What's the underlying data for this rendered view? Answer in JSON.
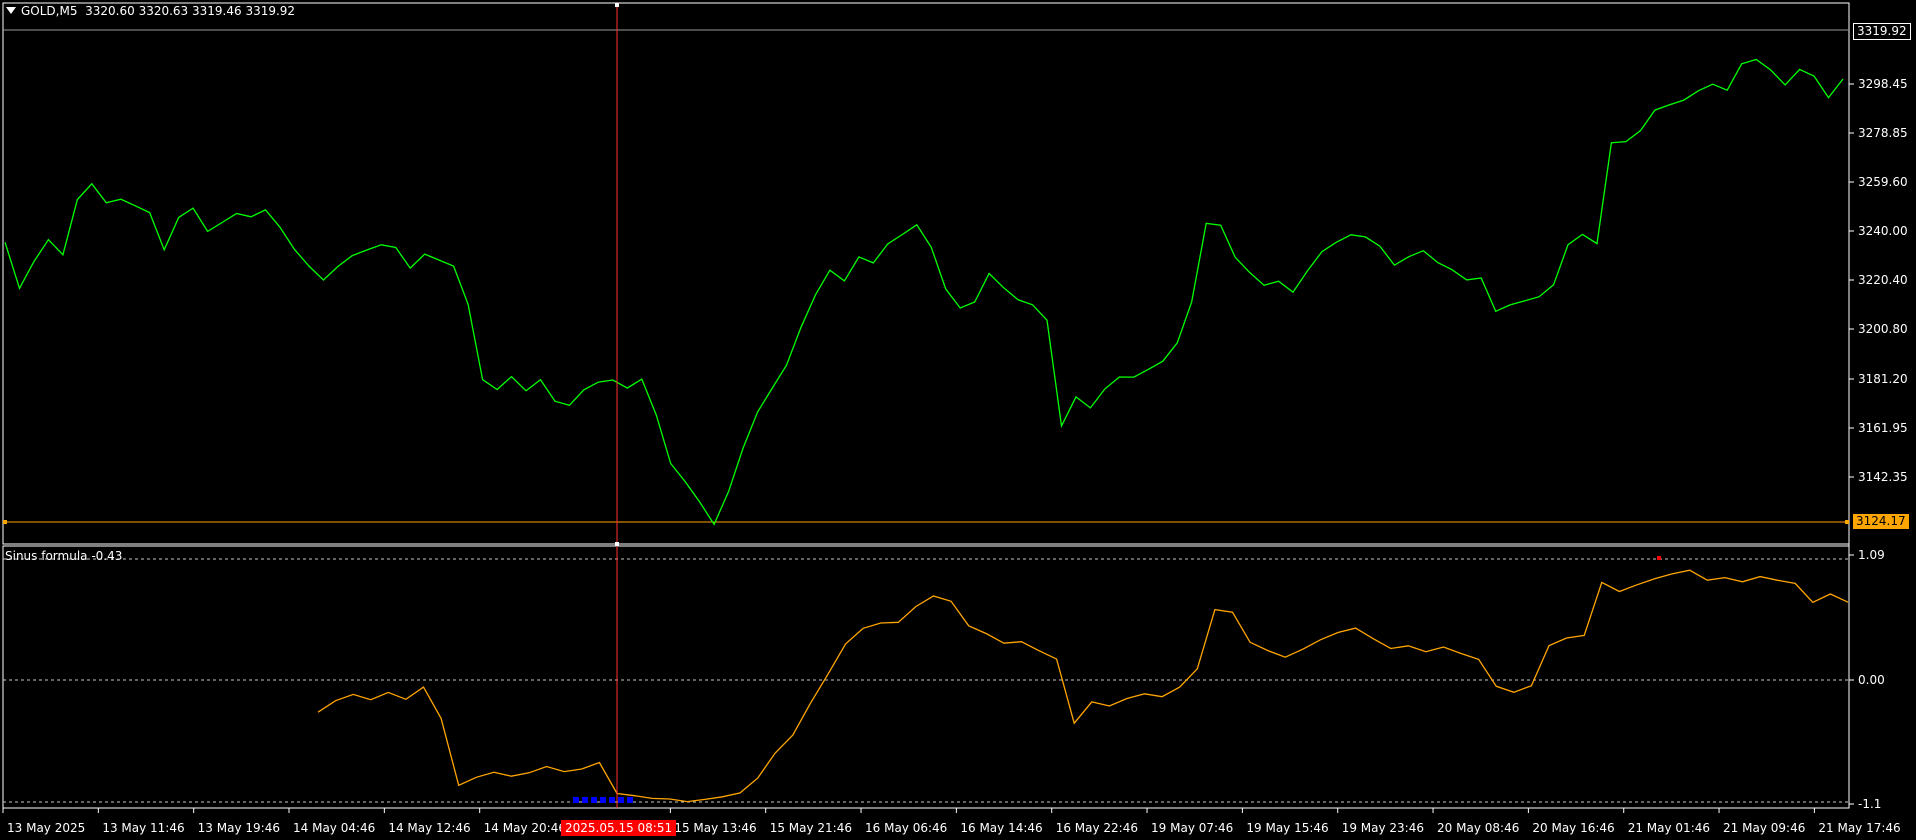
{
  "header": {
    "symbol": "GOLD,M5",
    "ohlc": "3320.60 3320.63 3319.46 3319.92"
  },
  "indicator": {
    "title": "Sinus formula -0.43"
  },
  "price_tags": {
    "current": "3319.92",
    "level": "3124.17"
  },
  "crosshair": {
    "time_label": "2025.05.15 08:51"
  },
  "colors": {
    "background": "#000000",
    "price_line": "#00FF00",
    "indicator_line": "#FFA500",
    "crosshair": "#FF3030",
    "level_line": "#FFA500",
    "low_markers": "#0000FF",
    "high_marker": "#FF0000",
    "axis": "#FFFFFF"
  },
  "chart_data": [
    {
      "type": "line",
      "title": "GOLD,M5",
      "y_ticks": [
        "3319.92",
        "3298.45",
        "3278.85",
        "3259.60",
        "3240.00",
        "3220.40",
        "3200.80",
        "3181.20",
        "3161.95",
        "3142.35"
      ],
      "ylim": [
        3130,
        3325
      ],
      "x_tick_labels": [
        "13 May 2025",
        "13 May 11:46",
        "13 May 19:46",
        "14 May 04:46",
        "14 May 12:46",
        "14 May 20:46",
        "15 May 13:46",
        "15 May 21:46",
        "16 May 06:46",
        "16 May 14:46",
        "16 May 22:46",
        "19 May 07:46",
        "19 May 15:46",
        "19 May 23:46",
        "20 May 08:46",
        "20 May 16:46",
        "21 May 01:46",
        "21 May 09:46",
        "21 May 17:46"
      ],
      "x_tick_positions": [
        0,
        4,
        8,
        12,
        16,
        20,
        28,
        32,
        36,
        40,
        44,
        48,
        52,
        56,
        60,
        64,
        68,
        72,
        76
      ],
      "series": [
        {
          "values": [
            3240,
            3222,
            3233,
            3242,
            3236,
            3258,
            3264,
            3256,
            3257,
            3254,
            3251,
            3236,
            3249,
            3253,
            3244,
            3248,
            3252,
            3251,
            3254,
            3247,
            3238,
            3231,
            3225,
            3230,
            3234,
            3236,
            3238,
            3237,
            3229,
            3235,
            3233,
            3231,
            3216,
            3186,
            3182,
            3187,
            3181,
            3185,
            3176,
            3174,
            3180,
            3183,
            3184,
            3181,
            3185,
            3171,
            3152,
            3145,
            3137,
            3128,
            3141,
            3158,
            3172,
            3181,
            3190,
            3205,
            3218,
            3228,
            3224,
            3234,
            3232,
            3240,
            3244,
            3248,
            3239,
            3222,
            3214,
            3216,
            3227,
            3221,
            3216,
            3214,
            3208,
            3166,
            3178,
            3174,
            3182,
            3187,
            3187,
            3190,
            3193,
            3200,
            3216,
            3247,
            3246,
            3233,
            3227,
            3222,
            3224,
            3220,
            3229,
            3237,
            3241,
            3244,
            3243,
            3239,
            3231,
            3234,
            3236,
            3231,
            3228,
            3224,
            3225,
            3212,
            3215,
            3217,
            3219,
            3224,
            3240,
            3244,
            3240,
            3280,
            3280,
            3284,
            3292,
            3294,
            3296,
            3300,
            3303,
            3301,
            3312,
            3314,
            3310,
            3304,
            3310,
            3307,
            3298,
            3305
          ]
        }
      ]
    },
    {
      "type": "line",
      "title": "Sinus formula -0.43",
      "y_ticks": [
        "1.09",
        "0.00",
        "-1.1"
      ],
      "ylim": [
        -1.12,
        1.1
      ],
      "series": [
        {
          "values": [
            -0.3,
            -0.18,
            -0.12,
            -0.18,
            -0.13,
            -0.2,
            -0.08,
            -0.35,
            -0.95,
            -0.88,
            -0.85,
            -0.9,
            -0.87,
            -0.8,
            -0.83,
            -0.8,
            -0.75,
            -1.05,
            -1.08,
            -1.1,
            -1.09,
            -1.1,
            -1.08,
            -1.07,
            -1.05,
            -0.92,
            -0.68,
            -0.5,
            -0.2,
            0.06,
            0.32,
            0.45,
            0.5,
            0.52,
            0.68,
            0.78,
            0.72,
            0.48,
            0.4,
            0.32,
            0.35,
            0.28,
            0.2,
            -0.4,
            -0.22,
            -0.26,
            -0.18,
            -0.12,
            -0.14,
            -0.06,
            0.09,
            0.62,
            0.6,
            0.34,
            0.28,
            0.22,
            0.28,
            0.35,
            0.41,
            0.46,
            0.38,
            0.3,
            0.32,
            0.25,
            0.28,
            0.22,
            0.18,
            -0.05,
            -0.1,
            -0.05,
            0.3,
            0.36,
            0.39,
            0.89,
            0.82,
            0.88,
            0.92,
            0.95,
            0.98,
            0.9,
            0.94,
            0.91,
            0.95,
            0.9,
            0.86,
            0.69,
            0.78,
            0.72
          ]
        }
      ],
      "markers": {
        "low_points": 7,
        "high_points": 1
      }
    }
  ]
}
